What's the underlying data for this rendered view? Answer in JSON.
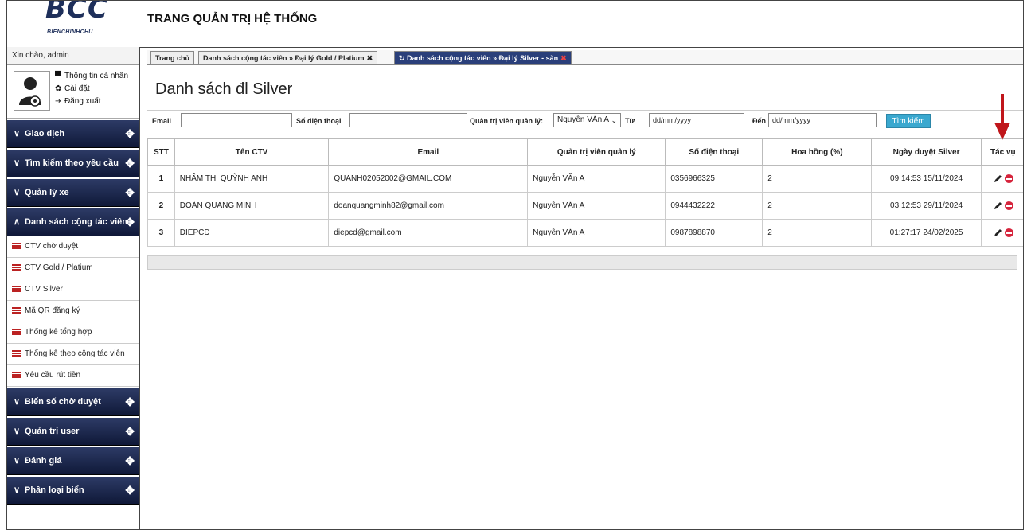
{
  "app": {
    "title": "TRANG QUẢN TRỊ HỆ THỐNG",
    "logo_text": "BCC",
    "logo_sub": "BIENCHINHCHU"
  },
  "sidebar": {
    "greeting": "Xin chào, admin",
    "user_links": [
      {
        "label": "Thông tin cá nhân",
        "icon": "comment-icon"
      },
      {
        "label": "Cài đặt",
        "icon": "gear-icon"
      },
      {
        "label": "Đăng xuất",
        "icon": "logout-icon"
      }
    ],
    "sections_top": [
      {
        "label": "Giao dịch"
      },
      {
        "label": "Tìm kiếm theo yêu cầu"
      },
      {
        "label": "Quản lý xe"
      },
      {
        "label": "Danh sách cộng tác viên"
      }
    ],
    "sub_items": [
      {
        "label": "CTV chờ duyệt"
      },
      {
        "label": "CTV Gold / Platium"
      },
      {
        "label": "CTV Silver"
      },
      {
        "label": "Mã QR đăng ký"
      },
      {
        "label": "Thống kê tổng hợp"
      },
      {
        "label": "Thống kê theo cộng tác viên"
      },
      {
        "label": "Yêu cầu rút tiền"
      }
    ],
    "sections_bottom": [
      {
        "label": "Biển số chờ duyệt"
      },
      {
        "label": "Quản trị user"
      },
      {
        "label": "Đánh giá"
      },
      {
        "label": "Phân loại biển"
      }
    ]
  },
  "tabs": [
    {
      "label": "Trang chủ"
    },
    {
      "label": "Danh sách cộng tác viên » Đại lý Gold / Platium",
      "close": "✖"
    },
    {
      "label": "Danh sách cộng tác viên » Đại lý Silver - sàn",
      "close": "✖"
    }
  ],
  "page": {
    "title": "Danh sách đl Silver"
  },
  "filters": {
    "email_label": "Email",
    "email_value": "",
    "phone_label": "Số điện thoại",
    "phone_value": "",
    "admin_label": "Quản trị viên quản lý:",
    "admin_selected": "Nguyễn VĂn A",
    "from_label": "Từ",
    "from_placeholder": "dd/mm/yyyy",
    "to_label": "Đến",
    "to_placeholder": "dd/mm/yyyy",
    "search_button": "Tìm kiếm"
  },
  "table": {
    "headers": [
      "STT",
      "Tên CTV",
      "Email",
      "Quản trị viên quản lý",
      "Số điện thoại",
      "Hoa hồng (%)",
      "Ngày duyệt Silver",
      "Tác vụ"
    ],
    "rows": [
      {
        "stt": "1",
        "name": "NHÂM THỊ QUỲNH ANH",
        "email": "QUANH02052002@GMAIL.COM",
        "admin": "Nguyễn VĂn A",
        "phone": "0356966325",
        "commission": "2",
        "date": "09:14:53 15/11/2024"
      },
      {
        "stt": "2",
        "name": "ĐOÀN QUANG MINH",
        "email": "doanquangminh82@gmail.com",
        "admin": "Nguyễn VĂn A",
        "phone": "0944432222",
        "commission": "2",
        "date": "03:12:53 29/11/2024"
      },
      {
        "stt": "3",
        "name": "DIEPCD",
        "email": "diepcd@gmail.com",
        "admin": "Nguyễn VĂn A",
        "phone": "0987898870",
        "commission": "2",
        "date": "01:27:17 24/02/2025"
      }
    ]
  },
  "colors": {
    "nav_dark": "#0f1838",
    "active_tab": "#2a3f7a",
    "search_button": "#3aa8cf",
    "delete_icon": "#d6243c",
    "annotation_arrow": "#c0161b"
  }
}
